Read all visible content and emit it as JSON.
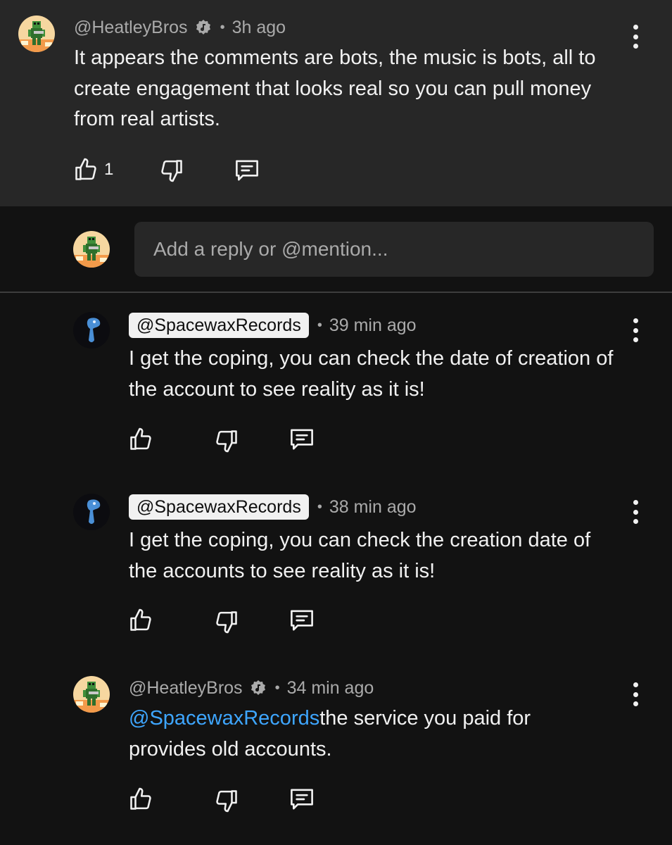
{
  "top_comment": {
    "author": "@HeatleyBros",
    "time": "3h ago",
    "text": "It appears the comments are bots, the music is bots, all to create engagement  that looks real so you can pull money from real artists.",
    "like_count": "1"
  },
  "reply_box": {
    "placeholder": "Add a reply or @mention..."
  },
  "replies": [
    {
      "author": "@SpacewaxRecords",
      "time": "39 min ago",
      "text": "I get the coping, you can check the date of creation of the account to see reality as it is!"
    },
    {
      "author": "@SpacewaxRecords",
      "time": "38 min ago",
      "text": "I get the coping, you can check the creation date of the accounts to see reality as it is!"
    },
    {
      "author": "@HeatleyBros",
      "time": "34 min ago",
      "mention": "@SpacewaxRecords",
      "text": "the service you paid for provides old accounts."
    }
  ],
  "separator": "•",
  "icons": [
    "thumbs-up-icon",
    "thumbs-down-icon",
    "reply-icon",
    "more-vert-icon",
    "verified-music-icon"
  ],
  "colors": {
    "background": "#121212",
    "top_comment_bg": "#272727",
    "mention": "#3ea6ff",
    "pill_bg": "#f1f1f1"
  }
}
